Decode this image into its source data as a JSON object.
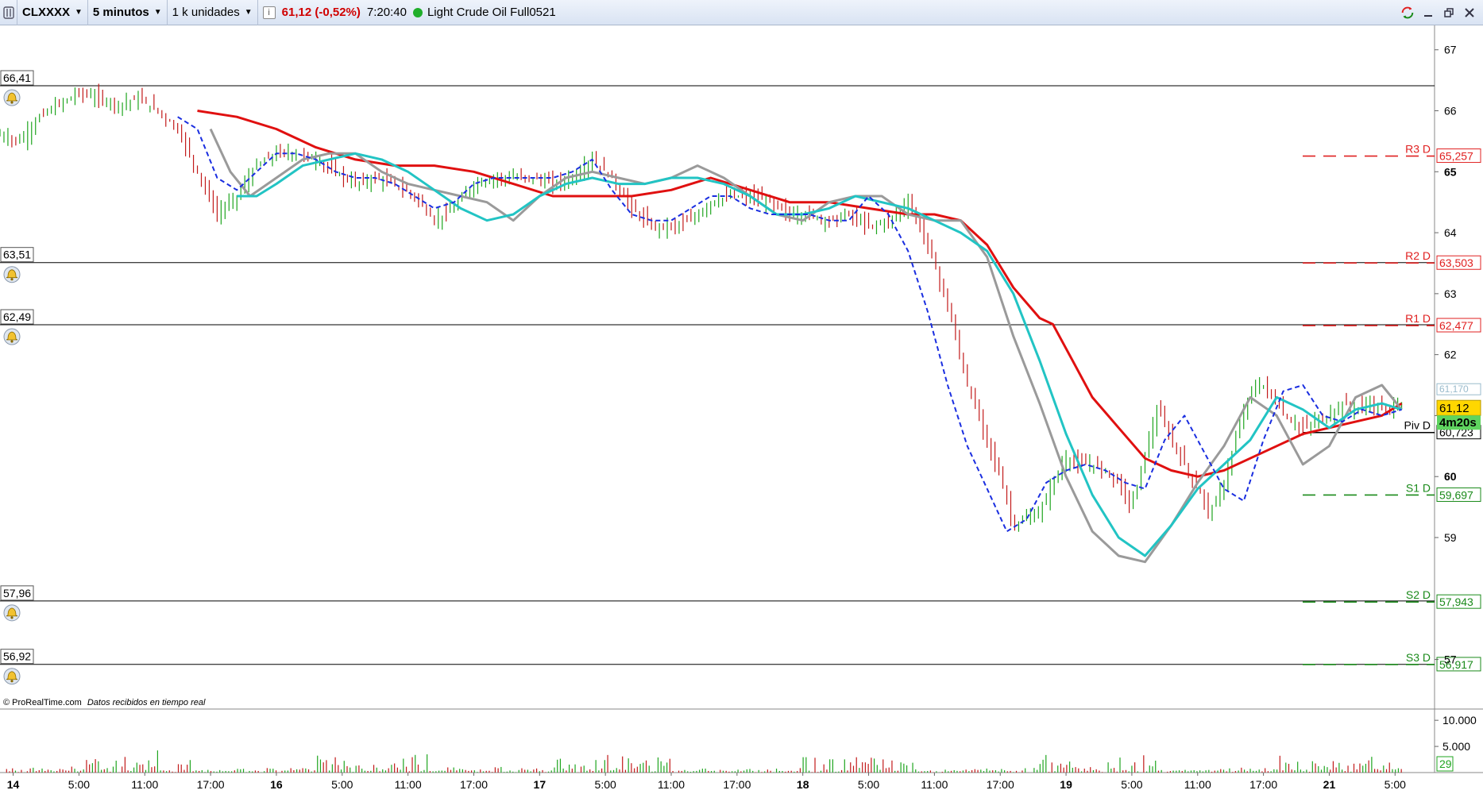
{
  "toolbar": {
    "instrument": "CLXXXX",
    "timeframe": "5 minutos",
    "units": "1 k unidades",
    "info_label": "i",
    "price_change": "61,12 (-0,52%)",
    "time": "7:20:40",
    "name": "Light Crude Oil Full0521",
    "icons": [
      "chart-type-icon",
      "info-icon",
      "status-dot-icon",
      "sync-icon",
      "minimize-icon",
      "restore-icon",
      "close-icon"
    ]
  },
  "copyright": "© ProRealTime.com",
  "realtime_note": "Datos recibidos en tiempo real",
  "colors": {
    "ma_red": "#e01010",
    "ma_gray": "#9a9a9a",
    "ma_cyan": "#22c4c4",
    "ma_blue_dash": "#1a2ee0",
    "resistance": "#e02020",
    "support": "#1a8a1a",
    "last_price_bg": "#ffd700",
    "timer_bg": "#5fd45f"
  },
  "chart_data": {
    "type": "line",
    "instrument": "Light Crude Oil Full0521",
    "timeframe": "5 minutos",
    "ylim": [
      56.2,
      67.4
    ],
    "y_ticks": [
      "67",
      "66",
      "65",
      "64",
      "63",
      "62",
      "61",
      "60",
      "59",
      "57"
    ],
    "y_ticks_bold": [
      "65",
      "60"
    ],
    "x_ticks": [
      "14",
      "5:00",
      "11:00",
      "17:00",
      "16",
      "5:00",
      "11:00",
      "17:00",
      "17",
      "5:00",
      "11:00",
      "17:00",
      "18",
      "5:00",
      "11:00",
      "17:00",
      "19",
      "5:00",
      "11:00",
      "17:00",
      "21",
      "5:00"
    ],
    "x_ticks_bold": [
      "14",
      "16",
      "17",
      "18",
      "19",
      "21"
    ],
    "x_range": [
      0,
      21.8
    ],
    "alert_levels": [
      {
        "label": "66,41",
        "value": 66.41
      },
      {
        "label": "63,51",
        "value": 63.51
      },
      {
        "label": "62,49",
        "value": 62.49
      },
      {
        "label": "57,96",
        "value": 57.96
      },
      {
        "label": "56,92",
        "value": 56.92
      }
    ],
    "pivots": [
      {
        "name": "R3 D",
        "label": "65,257",
        "value": 65.257,
        "kind": "resistance"
      },
      {
        "name": "R2 D",
        "label": "63,503",
        "value": 63.503,
        "kind": "resistance"
      },
      {
        "name": "R1 D",
        "label": "62,477",
        "value": 62.477,
        "kind": "resistance"
      },
      {
        "name": "Piv D",
        "label": "60,723",
        "value": 60.723,
        "kind": "pivot"
      },
      {
        "name": "S1 D",
        "label": "59,697",
        "value": 59.697,
        "kind": "support"
      },
      {
        "name": "S2 D",
        "label": "57,943",
        "value": 57.943,
        "kind": "support"
      },
      {
        "name": "S3 D",
        "label": "56,917",
        "value": 56.917,
        "kind": "support"
      }
    ],
    "last_price": {
      "label": "61,12",
      "value": 61.12
    },
    "timer": "4m20s",
    "hidden_price_label": "61,170",
    "price_series": {
      "x": [
        0,
        0.3,
        0.6,
        0.9,
        1.2,
        1.5,
        1.8,
        2.1,
        2.4,
        2.7,
        3.0,
        3.3,
        3.6,
        3.9,
        4.2,
        4.5,
        4.8,
        5.1,
        5.4,
        5.7,
        6.0,
        6.3,
        6.6,
        6.9,
        7.2,
        7.5,
        7.8,
        8.1,
        8.4,
        8.7,
        9.0,
        9.3,
        9.6,
        9.9,
        10.2,
        10.5,
        10.8,
        11.1,
        11.4,
        11.7,
        12.0,
        12.3,
        12.6,
        12.9,
        13.2,
        13.5,
        13.8,
        14.1,
        14.4,
        14.7,
        15.0,
        15.2,
        15.4,
        15.6,
        15.8,
        16.0,
        16.2,
        16.4,
        16.6,
        16.8,
        17.0,
        17.2,
        17.4,
        17.6,
        17.8,
        18.0,
        18.2,
        18.4,
        18.6,
        18.8,
        19.0,
        19.2,
        19.4,
        19.6,
        19.8,
        20.0,
        20.2,
        20.4,
        20.6,
        20.8,
        21.0,
        21.3
      ],
      "y": [
        65.6,
        65.5,
        65.9,
        66.1,
        66.3,
        66.2,
        66.1,
        66.2,
        66.0,
        65.7,
        65.0,
        64.3,
        64.6,
        65.1,
        65.3,
        65.3,
        65.2,
        65.0,
        64.8,
        64.9,
        64.8,
        64.6,
        64.2,
        64.4,
        64.8,
        64.9,
        64.9,
        64.9,
        64.8,
        64.9,
        65.2,
        64.9,
        64.4,
        64.1,
        64.1,
        64.2,
        64.5,
        64.6,
        64.6,
        64.5,
        64.3,
        64.3,
        64.2,
        64.3,
        64.1,
        64.2,
        64.5,
        63.8,
        62.8,
        61.5,
        60.6,
        60.0,
        59.2,
        59.3,
        59.4,
        59.9,
        60.3,
        60.2,
        60.2,
        60.1,
        59.9,
        59.5,
        60.4,
        61.1,
        60.6,
        60.2,
        59.8,
        59.4,
        59.9,
        60.7,
        61.4,
        61.5,
        61.2,
        60.9,
        60.8,
        60.9,
        61.0,
        61.2,
        61.1,
        61.2,
        61.1,
        61.2
      ]
    },
    "series": [
      {
        "color_key": "ma_red",
        "x": [
          3.0,
          3.6,
          4.2,
          4.8,
          5.4,
          6.0,
          6.6,
          7.2,
          7.8,
          8.4,
          9.0,
          9.6,
          10.2,
          10.8,
          11.4,
          12.0,
          12.6,
          13.2,
          13.8,
          14.2,
          14.6,
          15.0,
          15.4,
          15.8,
          16.0,
          16.3,
          16.6,
          17.0,
          17.4,
          17.8,
          18.2,
          18.6,
          19.0,
          19.4,
          19.8,
          20.2,
          20.6,
          21.0,
          21.3
        ],
        "y": [
          66.0,
          65.9,
          65.7,
          65.4,
          65.2,
          65.1,
          65.1,
          65.0,
          64.8,
          64.6,
          64.6,
          64.6,
          64.7,
          64.9,
          64.7,
          64.5,
          64.5,
          64.4,
          64.3,
          64.3,
          64.2,
          63.8,
          63.1,
          62.6,
          62.5,
          61.9,
          61.3,
          60.8,
          60.3,
          60.1,
          60.0,
          60.1,
          60.3,
          60.5,
          60.7,
          60.8,
          60.9,
          61.0,
          61.2
        ]
      },
      {
        "color_key": "ma_gray",
        "x": [
          3.2,
          3.5,
          3.8,
          4.2,
          4.6,
          5.0,
          5.4,
          5.8,
          6.2,
          6.6,
          7.0,
          7.4,
          7.8,
          8.2,
          8.6,
          9.0,
          9.4,
          9.8,
          10.2,
          10.6,
          11.0,
          11.4,
          11.8,
          12.2,
          12.6,
          13.0,
          13.4,
          13.8,
          14.2,
          14.6,
          15.0,
          15.4,
          15.8,
          16.2,
          16.6,
          17.0,
          17.4,
          17.8,
          18.2,
          18.6,
          19.0,
          19.4,
          19.8,
          20.2,
          20.6,
          21.0,
          21.3
        ],
        "y": [
          65.7,
          65.0,
          64.6,
          64.9,
          65.2,
          65.3,
          65.3,
          65.0,
          64.8,
          64.7,
          64.6,
          64.5,
          64.2,
          64.6,
          64.9,
          65.0,
          64.9,
          64.8,
          64.9,
          65.1,
          64.9,
          64.6,
          64.3,
          64.2,
          64.5,
          64.6,
          64.6,
          64.3,
          64.2,
          64.2,
          63.6,
          62.3,
          61.2,
          60.0,
          59.1,
          58.7,
          58.6,
          59.2,
          59.9,
          60.5,
          61.3,
          61.0,
          60.2,
          60.5,
          61.3,
          61.5,
          61.1
        ]
      },
      {
        "color_key": "ma_cyan",
        "x": [
          3.6,
          3.9,
          4.2,
          4.6,
          5.0,
          5.4,
          5.8,
          6.2,
          6.6,
          7.0,
          7.4,
          7.8,
          8.2,
          8.6,
          9.0,
          9.4,
          9.8,
          10.2,
          10.6,
          11.0,
          11.4,
          11.8,
          12.2,
          12.6,
          13.0,
          13.4,
          13.8,
          14.2,
          14.6,
          15.0,
          15.4,
          15.8,
          16.2,
          16.6,
          17.0,
          17.4,
          17.8,
          18.2,
          18.6,
          19.0,
          19.4,
          19.8,
          20.2,
          20.6,
          21.0,
          21.3
        ],
        "y": [
          64.6,
          64.6,
          64.8,
          65.1,
          65.2,
          65.3,
          65.2,
          65.0,
          64.7,
          64.4,
          64.2,
          64.3,
          64.6,
          64.8,
          64.9,
          64.8,
          64.8,
          64.9,
          64.9,
          64.8,
          64.6,
          64.3,
          64.3,
          64.4,
          64.6,
          64.5,
          64.4,
          64.2,
          64.0,
          63.7,
          63.0,
          61.9,
          60.7,
          59.7,
          59.0,
          58.7,
          59.2,
          59.8,
          60.2,
          60.6,
          61.3,
          61.1,
          60.8,
          61.1,
          61.2,
          61.1
        ]
      },
      {
        "color_key": "ma_blue_dash",
        "x": [
          2.7,
          3.0,
          3.3,
          3.6,
          3.9,
          4.2,
          4.5,
          4.8,
          5.1,
          5.4,
          5.7,
          6.0,
          6.3,
          6.6,
          6.9,
          7.2,
          7.5,
          7.8,
          8.1,
          8.4,
          8.7,
          9.0,
          9.3,
          9.6,
          9.9,
          10.2,
          10.5,
          10.8,
          11.1,
          11.4,
          11.7,
          12.0,
          12.3,
          12.6,
          12.9,
          13.2,
          13.5,
          13.8,
          14.1,
          14.4,
          14.7,
          15.0,
          15.3,
          15.6,
          15.9,
          16.2,
          16.5,
          16.8,
          17.1,
          17.4,
          17.7,
          18.0,
          18.3,
          18.6,
          18.9,
          19.2,
          19.5,
          19.8,
          20.1,
          20.4,
          20.7,
          21.0,
          21.3
        ],
        "y": [
          65.9,
          65.7,
          64.9,
          64.7,
          65.0,
          65.3,
          65.3,
          65.2,
          65.0,
          64.9,
          64.9,
          64.8,
          64.6,
          64.4,
          64.5,
          64.8,
          64.9,
          64.9,
          64.9,
          64.9,
          65.0,
          65.2,
          64.7,
          64.3,
          64.2,
          64.2,
          64.4,
          64.6,
          64.6,
          64.4,
          64.3,
          64.3,
          64.3,
          64.2,
          64.2,
          64.6,
          64.3,
          63.7,
          62.7,
          61.5,
          60.5,
          59.8,
          59.1,
          59.3,
          59.9,
          60.1,
          60.2,
          60.1,
          59.9,
          59.8,
          60.6,
          61.0,
          60.4,
          59.8,
          59.6,
          60.6,
          61.4,
          61.5,
          61.0,
          60.9,
          61.1,
          61.0,
          61.1
        ]
      }
    ],
    "volume": {
      "ylim": [
        0,
        12000
      ],
      "y_ticks": [
        "10.000",
        "5.000"
      ],
      "last_value_label": "29"
    }
  }
}
